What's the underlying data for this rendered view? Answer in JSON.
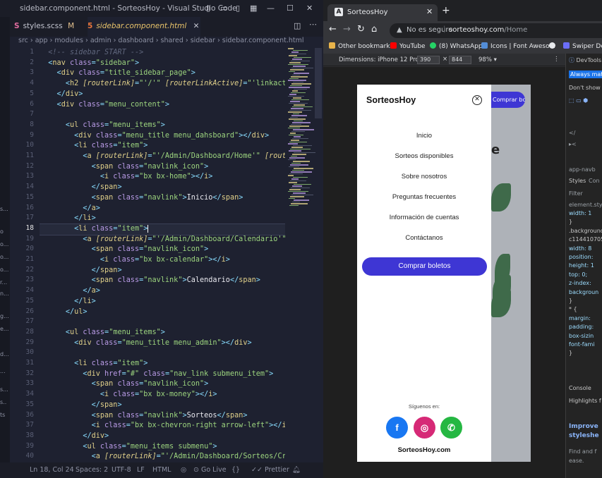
{
  "vscode": {
    "window_title": "sidebar.component.html - SorteosHoy - Visual Studio Code",
    "tabs": [
      {
        "label": "styles.scss",
        "badge": "M",
        "icon": "S"
      },
      {
        "label": "sidebar.component.html",
        "icon": "5"
      }
    ],
    "breadcrumb": "src › app › modules › admin › dashboard › shared › sidebar › sidebar.component.html",
    "activity_labels": [
      "s...",
      "o",
      "o...",
      "o...",
      "o...",
      "r...",
      "n...",
      "g...",
      "e...",
      "d...",
      "...",
      "s...",
      "s..",
      "ts"
    ],
    "line_numbers": [
      "1",
      "2",
      "3",
      "4",
      "5",
      "6",
      "7",
      "8",
      "9",
      "10",
      "11",
      "12",
      "13",
      "14",
      "15",
      "16",
      "17",
      "18",
      "19",
      "20",
      "21",
      "22",
      "23",
      "24",
      "25",
      "26",
      "27",
      "28",
      "29",
      "30",
      "31",
      "32",
      "33",
      "34",
      "35",
      "36",
      "37",
      "38",
      "39",
      "40"
    ],
    "current_line": "18",
    "status": {
      "position": "Ln 18, Col 24",
      "spaces": "Spaces: 2",
      "encoding": "UTF-8",
      "eol": "LF",
      "language": "HTML",
      "go_live": "Go Live",
      "prettier": "Prettier"
    }
  },
  "browser": {
    "tab_title": "SorteosHoy",
    "tab_favicon": "A",
    "not_secure": "No es seguro",
    "url_host": "sorteoshoy.com",
    "url_path": "/Home",
    "bookmarks": [
      "Other bookmarks",
      "YouTube",
      "(8) WhatsApp",
      "Icons | Font Aweso...",
      "Swiper Dem"
    ],
    "device": {
      "label": "Dimensions: iPhone 12 Pro",
      "width": "390",
      "height": "844",
      "zoom": "98%"
    }
  },
  "site": {
    "brand": "SorteosHoy",
    "menu": [
      "Inicio",
      "Sorteos disponibles",
      "Sobre nosotros",
      "Preguntas frecuentes",
      "Información de cuentas",
      "Contáctanos"
    ],
    "buy_button": "Comprar boletos",
    "background_button": "Comprar boletos",
    "background_heading_fragment": "e",
    "follow_label": "Síguenos en:",
    "social": [
      {
        "name": "facebook-icon",
        "glyph": "f",
        "color": "#1877f2"
      },
      {
        "name": "instagram-icon",
        "glyph": "◎",
        "color": "#d62976"
      },
      {
        "name": "whatsapp-icon",
        "glyph": "✆",
        "color": "#25b742"
      }
    ],
    "footer": "SorteosHoy.com"
  },
  "devtools": {
    "title": "DevTools",
    "banner": "Always match",
    "dont_show": "Don't show",
    "tabs": [
      "Styles",
      "Con"
    ],
    "filter": "Filter",
    "element_style": "element.sty",
    "rules": [
      "width: 1",
      "}",
      ".background",
      "c1144107051",
      "width: 8",
      "position:",
      "height: 1",
      "top: 0;",
      "z-index:",
      "backgroun",
      "}",
      "* {",
      "margin: ",
      "padding:",
      "box-sizin",
      "font-fami",
      "}"
    ],
    "console": "Console",
    "highlights": "Highlights f",
    "improve": "Improve",
    "stylesheet": "styleshe",
    "find": "Find and f",
    "ease": "ease.",
    "crumb": "app-navb"
  }
}
